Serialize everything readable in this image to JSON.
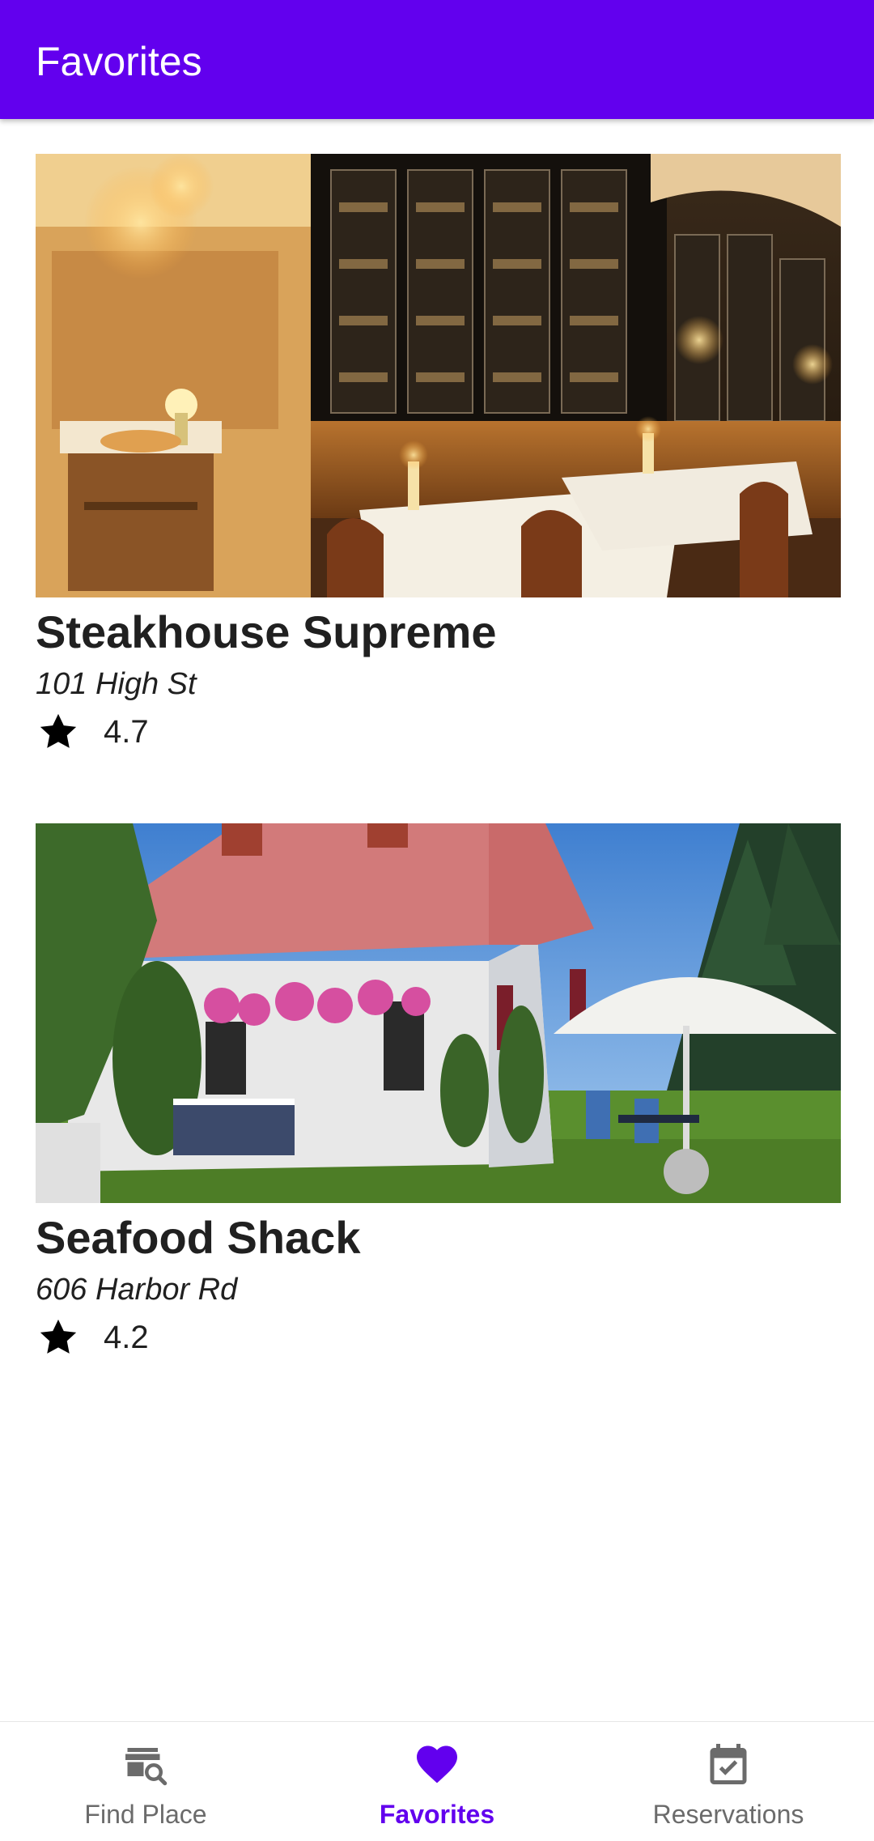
{
  "app_bar": {
    "title": "Favorites"
  },
  "favorites": [
    {
      "name": "Steakhouse Supreme",
      "address": "101 High St",
      "rating": "4.7"
    },
    {
      "name": "Seafood Shack",
      "address": "606 Harbor Rd",
      "rating": "4.2"
    }
  ],
  "bottom_nav": {
    "items": [
      {
        "label": "Find Place",
        "icon": "find-place-icon"
      },
      {
        "label": "Favorites",
        "icon": "heart-icon",
        "active": true
      },
      {
        "label": "Reservations",
        "icon": "calendar-check-icon"
      }
    ]
  },
  "colors": {
    "primary": "#6200ee",
    "inactive": "#6b6b6b"
  }
}
